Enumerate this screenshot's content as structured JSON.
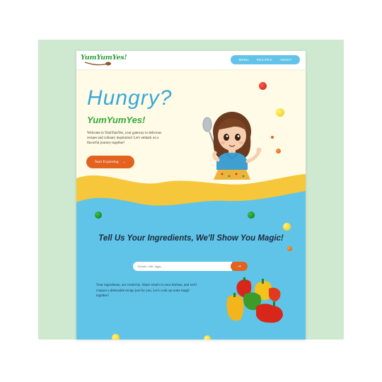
{
  "brand": {
    "logo_text": "YumYumYes!"
  },
  "nav": {
    "items": [
      "MENU",
      "RECIPES",
      "ABOUT"
    ]
  },
  "hero": {
    "title": "Hungry?",
    "subtitle": "YumYumYes!",
    "description": "Welcome to YumYumYes, your gateway to delicious recipes and culinary inspiration! Let's embark on a flavorful journey together!",
    "cta_label": "Start Exploring",
    "cta_icon": "arrow-right-icon"
  },
  "ingredients": {
    "title": "Tell Us Your Ingredients, We'll Show You Magic!",
    "search_placeholder": "Tomato, milk, eggs...",
    "search_button_icon": "arrow-right-icon",
    "description": "Your ingredients, our creativity. Share what's in your kitchen, and we'll conjure a delectable recipe just for you. Let's cook up some magic together!"
  },
  "colors": {
    "accent_orange": "#e2621e",
    "sky_blue": "#62c3e8",
    "title_blue": "#3aa7d8",
    "green": "#34a93b",
    "wave_yellow": "#f6c73a",
    "section_blue": "#5fc4e8",
    "backdrop_green": "#cfe8d0"
  }
}
